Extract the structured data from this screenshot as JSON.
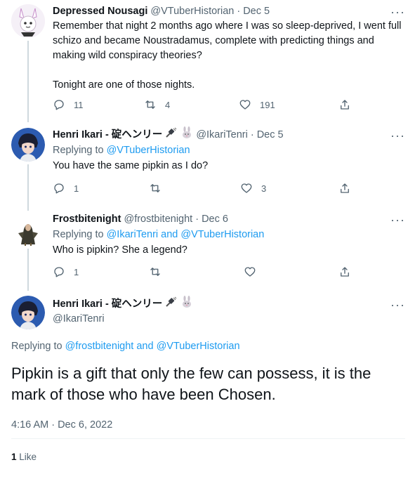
{
  "tweets": [
    {
      "name": "Depressed Nousagi",
      "handle": "@VTuberHistorian",
      "dot": "·",
      "time": "Dec 5",
      "more": "···",
      "text": "Remember that night 2 months ago where I was so sleep-deprived, I went full schizo and became Noustradamus, complete with predicting things and making wild conspiracy theories?\n\nTonight are one of those nights.",
      "replies": "11",
      "retweets": "4",
      "likes": "191"
    },
    {
      "name": "Henri Ikari - 碇ヘンリー",
      "handle": "@IkariTenri",
      "dot": "·",
      "time": "Dec 5",
      "more": "···",
      "replying_prefix": "Replying to ",
      "replying_to": "@VTuberHistorian",
      "text": "You have the same pipkin as I do?",
      "replies": "1",
      "retweets": "",
      "likes": "3"
    },
    {
      "name": "Frostbitenight",
      "handle": "@frostbitenight",
      "dot": "·",
      "time": "Dec 6",
      "more": "···",
      "replying_prefix": "Replying to ",
      "replying_to": "@IkariTenri and @VTuberHistorian",
      "text": "Who is pipkin? She a legend?",
      "replies": "1",
      "retweets": "",
      "likes": ""
    }
  ],
  "main_tweet": {
    "name": "Henri Ikari - 碇ヘンリー",
    "handle": "@IkariTenri",
    "more": "···",
    "replying_prefix": "Replying to ",
    "replying_to": "@frostbitenight and @VTuberHistorian",
    "text": "Pipkin is a gift that only the few can possess, it is the mark of those who have been Chosen.",
    "timestamp": "4:16 AM · Dec 6, 2022",
    "likes_count": "1",
    "likes_label": "Like"
  },
  "colors": {
    "accent": "#1d9bf0",
    "secondary_text": "#536471",
    "thread_line": "#cfd9de"
  }
}
